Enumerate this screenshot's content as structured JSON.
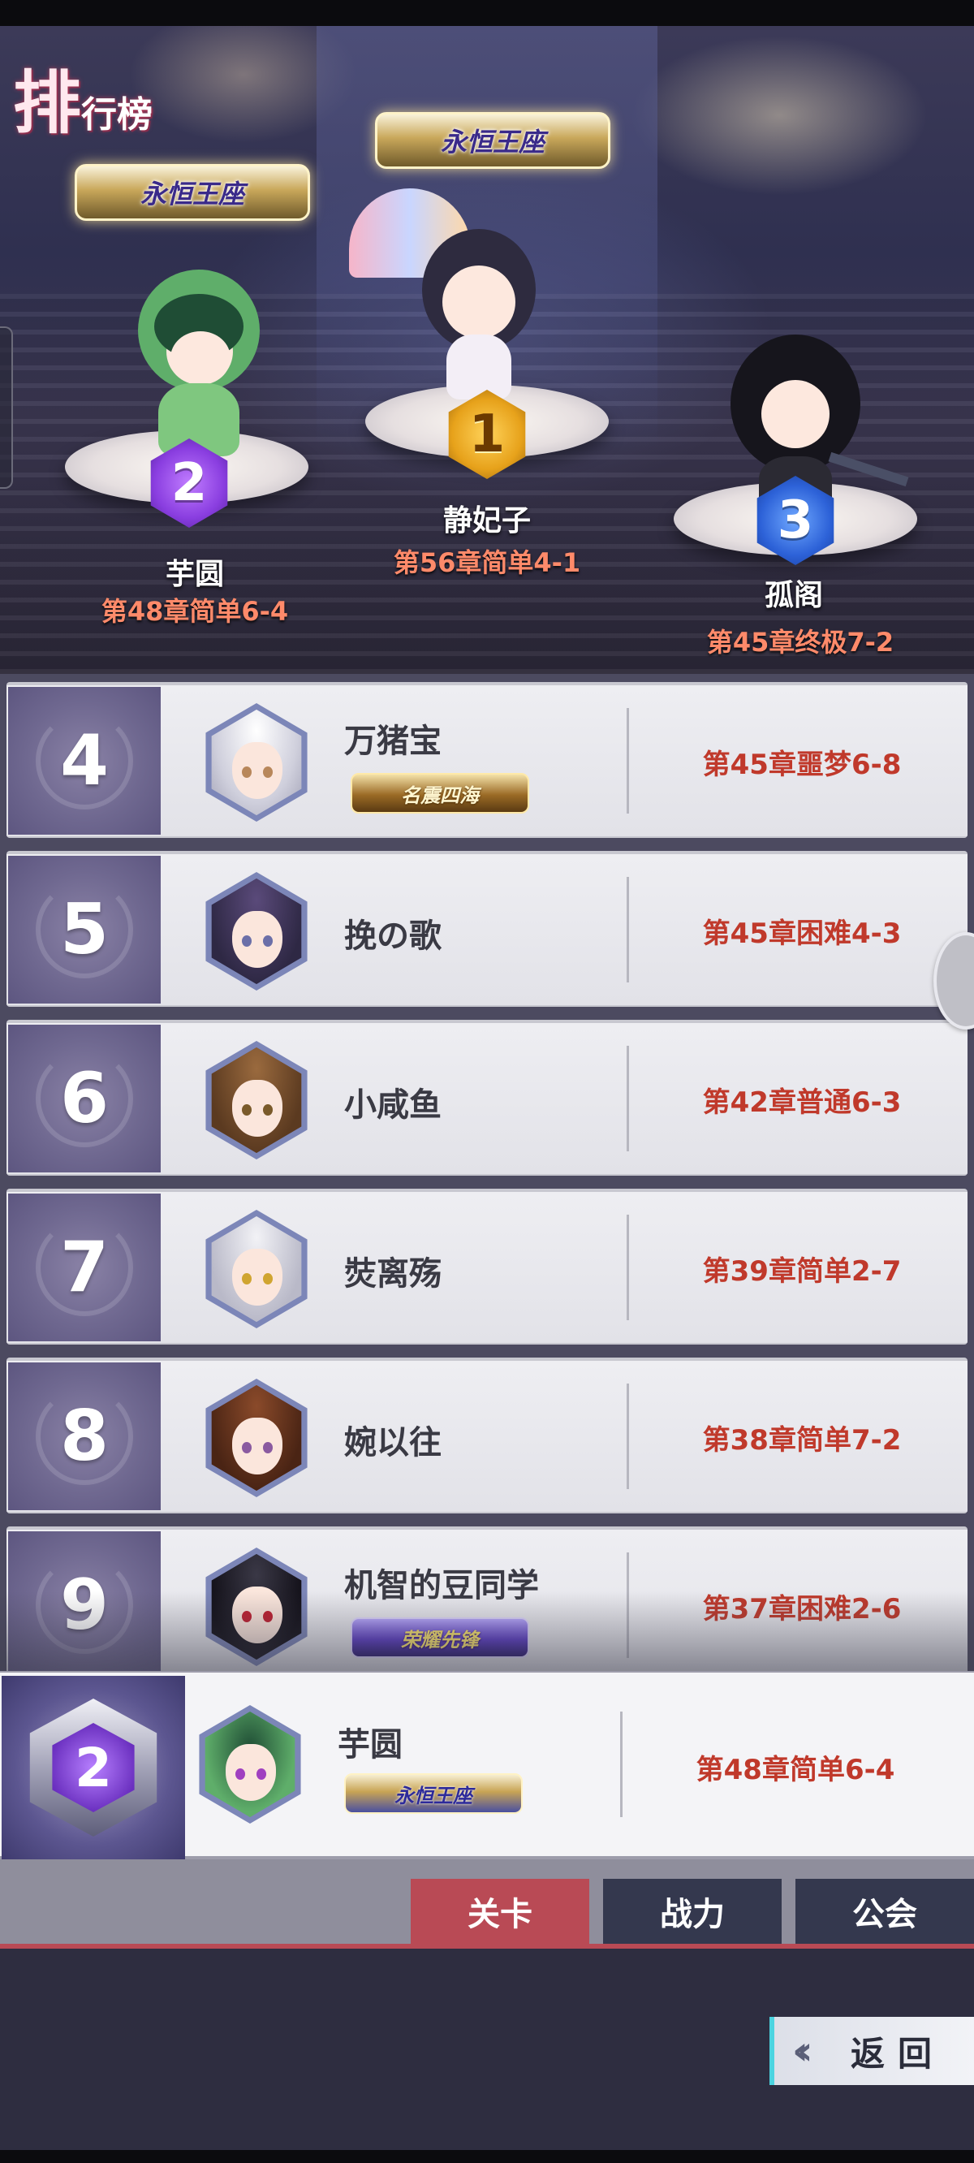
{
  "header": {
    "title_big": "排",
    "title_small": "行榜"
  },
  "podium": [
    {
      "rank": "1",
      "name": "静妃子",
      "stage": "第56章简单4-1",
      "crown_text": "永恒王座"
    },
    {
      "rank": "2",
      "name": "芋圆",
      "stage": "第48章简单6-4",
      "crown_text": "永恒王座"
    },
    {
      "rank": "3",
      "name": "孤阁",
      "stage": "第45章终极7-2"
    }
  ],
  "rows": [
    {
      "rank": "4",
      "name": "万猪宝",
      "stage": "第45章噩梦6-8",
      "badge": "名震四海"
    },
    {
      "rank": "5",
      "name": "挽の歌",
      "stage": "第45章困难4-3"
    },
    {
      "rank": "6",
      "name": "小咸鱼",
      "stage": "第42章普通6-3"
    },
    {
      "rank": "7",
      "name": "焋离殇",
      "stage": "第39章简单2-7"
    },
    {
      "rank": "8",
      "name": "婉以往",
      "stage": "第38章简单7-2"
    },
    {
      "rank": "9",
      "name": "机智的豆同学",
      "stage": "第37章困难2-6",
      "badge": "荣耀先锋"
    }
  ],
  "me": {
    "rank": "2",
    "name": "芋圆",
    "stage": "第48章简单6-4",
    "badge": "永恒王座"
  },
  "tabs": [
    {
      "label": "关卡",
      "active": true
    },
    {
      "label": "战力",
      "active": false
    },
    {
      "label": "公会",
      "active": false
    }
  ],
  "back_label": "返回",
  "colors": {
    "accent": "#b94a55",
    "stage_text": "#c0392b",
    "tab_inactive": "#34384e"
  }
}
